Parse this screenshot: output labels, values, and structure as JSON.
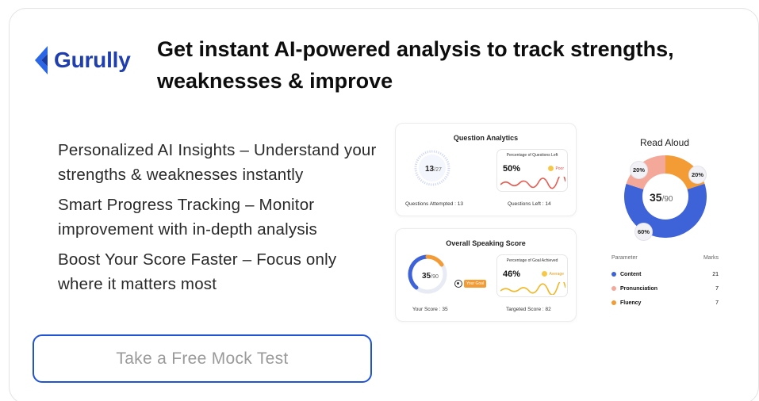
{
  "brand": {
    "name": "Gurully",
    "color": "#1f3fae"
  },
  "headline": "Get instant AI-powered analysis to track strengths, weaknesses & improve",
  "features": [
    "Personalized AI Insights – Understand your strengths & weaknesses instantly",
    "Smart Progress Tracking – Monitor improvement with in-depth analysis",
    "Boost Your Score Faster – Focus only where it matters most"
  ],
  "cta": {
    "label": "Take a Free Mock Test",
    "border_color": "#2153d6"
  },
  "question_analytics": {
    "title": "Question Analytics",
    "score": "13",
    "total": "/27",
    "card_label": "Percentage of Questions Left",
    "percent": "50%",
    "badge": "Poor",
    "attempted": "Questions Attempted : 13",
    "left": "Questions Left : 14"
  },
  "overall_speaking": {
    "title": "Overall Speaking Score",
    "score": "35",
    "total": "/90",
    "progress_fraction": 0.39,
    "goal_label": "Your Goal",
    "card_label": "Percentage of Goal Achieved",
    "percent": "46%",
    "badge": "Average",
    "your_score": "Your Score : 35",
    "targeted": "Targeted Score : 82"
  },
  "read_aloud": {
    "title": "Read Aloud",
    "score": "35",
    "total": "/90",
    "pills": [
      "20%",
      "20%",
      "60%"
    ],
    "table": {
      "headers": [
        "Parameter",
        "Marks"
      ],
      "rows": [
        {
          "name": "Content",
          "marks": "21",
          "color": "#3e62d8"
        },
        {
          "name": "Pronunciation",
          "marks": "7",
          "color": "#f3a89a"
        },
        {
          "name": "Fluency",
          "marks": "7",
          "color": "#f39b34"
        }
      ]
    }
  }
}
